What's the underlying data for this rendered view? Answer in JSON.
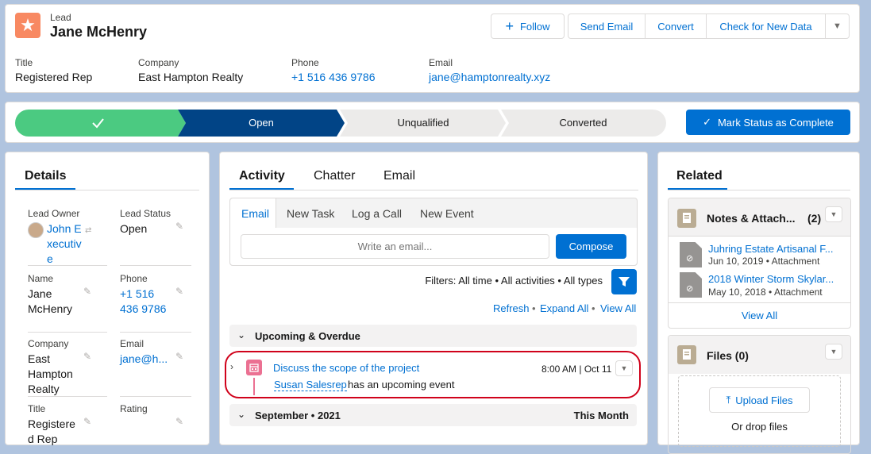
{
  "header": {
    "object_type": "Lead",
    "record_name": "Jane McHenry",
    "buttons": {
      "follow": "Follow",
      "send_email": "Send Email",
      "convert": "Convert",
      "check": "Check for New Data"
    },
    "fields": [
      {
        "label": "Title",
        "value": "Registered Rep"
      },
      {
        "label": "Company",
        "value": "East Hampton Realty"
      },
      {
        "label": "Phone",
        "value": "+1 516 436 9786"
      },
      {
        "label": "Email",
        "value": "jane@hamptonrealty.xyz"
      }
    ]
  },
  "path": {
    "stages": [
      "Open",
      "Unqualified",
      "Converted"
    ],
    "mark_button": "Mark Status as Complete"
  },
  "details": {
    "tab": "Details",
    "fields": [
      {
        "label": "Lead Owner",
        "value": "John Executive"
      },
      {
        "label": "Lead Status",
        "value": "Open"
      },
      {
        "label": "Name",
        "value": "Jane McHenry"
      },
      {
        "label": "Phone",
        "value": "+1 516 436 9786"
      },
      {
        "label": "Company",
        "value": "East Hampton Realty"
      },
      {
        "label": "Email",
        "value": "jane@h..."
      },
      {
        "label": "Title",
        "value": "Registered Rep"
      },
      {
        "label": "Rating",
        "value": ""
      }
    ]
  },
  "activity": {
    "tabs": [
      "Activity",
      "Chatter",
      "Email"
    ],
    "subtabs": [
      "Email",
      "New Task",
      "Log a Call",
      "New Event"
    ],
    "email_placeholder": "Write an email...",
    "compose": "Compose",
    "filters": "Filters: All time • All activities • All types",
    "refresh": "Refresh",
    "expand_all": "Expand All",
    "view_all": "View All",
    "upcoming_header": "Upcoming & Overdue",
    "event": {
      "title": "Discuss the scope of the project",
      "time": "8:00 AM | Oct 11",
      "person": "Susan Salesrep",
      "suffix": "has an upcoming event"
    },
    "month_header": "September • 2021",
    "month_label": "This Month"
  },
  "related": {
    "tab": "Related",
    "notes_title": "Notes & Attach...",
    "notes_count": "(2)",
    "notes": [
      {
        "title": "Juhring Estate Artisanal F...",
        "date": "Jun 10, 2019",
        "type": "Attachment"
      },
      {
        "title": "2018 Winter Storm Skylar...",
        "date": "May 10, 2018",
        "type": "Attachment"
      }
    ],
    "view_all": "View All",
    "files_title": "Files (0)",
    "upload": "Upload Files",
    "drop": "Or drop files"
  },
  "colors": {
    "brand": "#0070d2",
    "dark_blue": "#014486",
    "green": "#4bca81",
    "lead_orange": "#f88962",
    "event_pink": "#eb7092",
    "highlight_red": "#d0021b"
  }
}
